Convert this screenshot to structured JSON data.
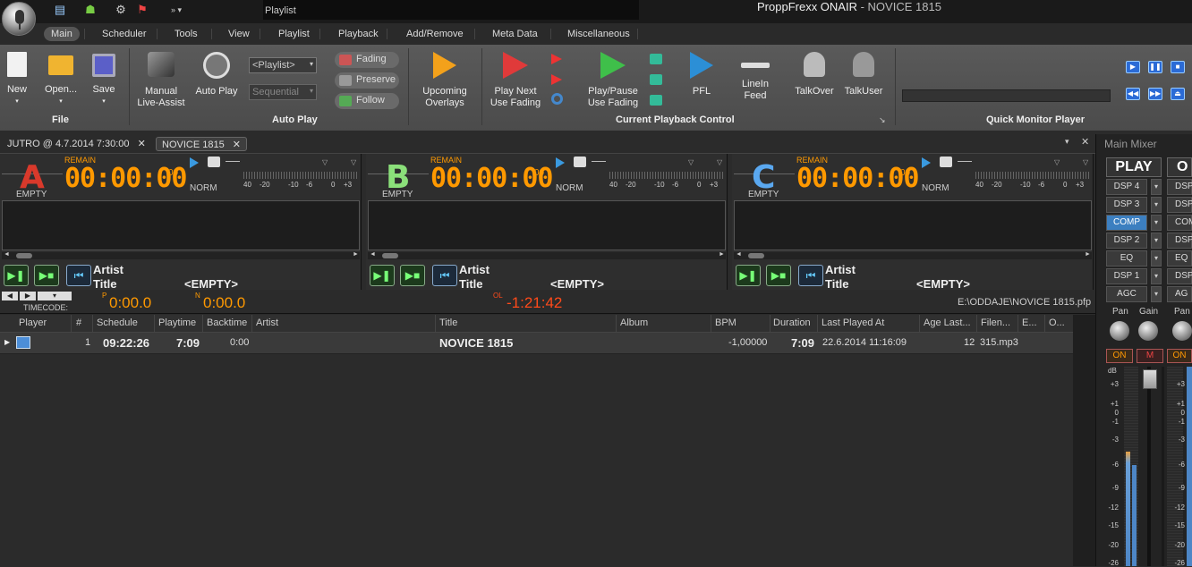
{
  "app": {
    "title_main": "ProppFrexx ONAIR",
    "title_sep": " - ",
    "title_doc": "NOVICE 1815",
    "context_tab": "Playlist"
  },
  "menu": {
    "tabs": [
      "Main",
      "Scheduler",
      "Tools",
      "View",
      "Playlist",
      "Playback",
      "Add/Remove",
      "Meta Data",
      "Miscellaneous"
    ]
  },
  "ribbon": {
    "file": {
      "label": "File",
      "new": "New",
      "open": "Open...",
      "save": "Save"
    },
    "autoplay": {
      "label": "Auto Play",
      "manual": [
        "Manual",
        "Live-Assist"
      ],
      "auto": "Auto Play",
      "playlist_drop": "<Playlist>",
      "sequential_drop": "Sequential",
      "fading": "Fading",
      "preserve": "Preserve",
      "follow": "Follow"
    },
    "upcoming": [
      "Upcoming",
      "Overlays"
    ],
    "playback": {
      "label": "Current Playback Control",
      "playnext": [
        "Play Next",
        "Use Fading"
      ],
      "playpause": [
        "Play/Pause",
        "Use Fading"
      ],
      "pfl": "PFL",
      "linein": [
        "LineIn",
        "Feed"
      ],
      "talkover": "TalkOver",
      "talkuser": "TalkUser"
    },
    "qmp": {
      "label": "Quick Monitor Player"
    }
  },
  "doctabs": [
    {
      "label": "JUTRO @ 4.7.2014 7:30:00"
    },
    {
      "label": "NOVICE 1815"
    }
  ],
  "players": [
    {
      "letter": "A",
      "color": "#d9392b",
      "state": "EMPTY",
      "remain": "REMAIN",
      "time": "00:00:00",
      "frac": "00",
      "mode": "NORM",
      "scale": [
        "40",
        "-20",
        "-10",
        "-6",
        "0",
        "+3"
      ],
      "artist_label": "Artist",
      "title_label": "Title",
      "title_value": ""
    },
    {
      "letter": "B",
      "color": "#8be07a",
      "state": "EMPTY",
      "remain": "REMAIN",
      "time": "00:00:00",
      "frac": "00",
      "mode": "NORM",
      "scale": [
        "40",
        "-20",
        "-10",
        "-6",
        "0",
        "+3"
      ],
      "artist_label": "Artist",
      "title_label": "Title",
      "title_value": "<EMPTY>"
    },
    {
      "letter": "C",
      "color": "#5aa8f0",
      "state": "EMPTY",
      "remain": "REMAIN",
      "time": "00:00:00",
      "frac": "00",
      "mode": "NORM",
      "scale": [
        "40",
        "-20",
        "-10",
        "-6",
        "0",
        "+3"
      ],
      "artist_label": "Artist",
      "title_label": "Title",
      "title_value": "<EMPTY>"
    }
  ],
  "player_a_empty": "<EMPTY>",
  "timecode": {
    "label": "TIMECODE:",
    "p_label": "P",
    "p_value": "0:00.0",
    "n_label": "N",
    "n_value": "0:00.0",
    "ol_label": "OL",
    "ol_value": "-1:21:42",
    "path": "E:\\ODDAJE\\NOVICE 1815.pfp"
  },
  "grid": {
    "headers": [
      "Player",
      "#",
      "Schedule",
      "Playtime",
      "Backtime",
      "Artist",
      "Title",
      "Album",
      "BPM",
      "Duration",
      "Last Played At",
      "Age Last...",
      "Filen...",
      "E...",
      "O..."
    ],
    "row": {
      "num": "1",
      "schedule": "09:22:26",
      "playtime": "7:09",
      "backtime": "0:00",
      "artist": "",
      "title": "NOVICE 1815",
      "album": "",
      "bpm": "-1,00000",
      "duration": "7:09",
      "last_played": "22.6.2014 11:16:09",
      "age": "12",
      "filename": "315.mp3"
    }
  },
  "mixer": {
    "title": "Main Mixer",
    "play": "PLAY",
    "play2": "O",
    "strip": [
      "DSP 4",
      "DSP 3",
      "COMP",
      "DSP 2",
      "EQ",
      "DSP 1",
      "AGC"
    ],
    "strip2": [
      "DSP",
      "DSP",
      "COM",
      "DSP",
      "EQ",
      "DSP",
      "AG"
    ],
    "pan": "Pan",
    "gain": "Gain",
    "pan2": "Pan",
    "on": "ON",
    "m": "M",
    "on2": "ON",
    "db": "dB",
    "scale": [
      "+3",
      "+1",
      "0",
      "-1",
      "-3",
      "-6",
      "-9",
      "-12",
      "-15",
      "-20",
      "-26"
    ]
  },
  "colors": {
    "accent_orange": "#ff9900",
    "ol_red": "#ff4a1a",
    "select_blue": "#3c7fc0"
  }
}
